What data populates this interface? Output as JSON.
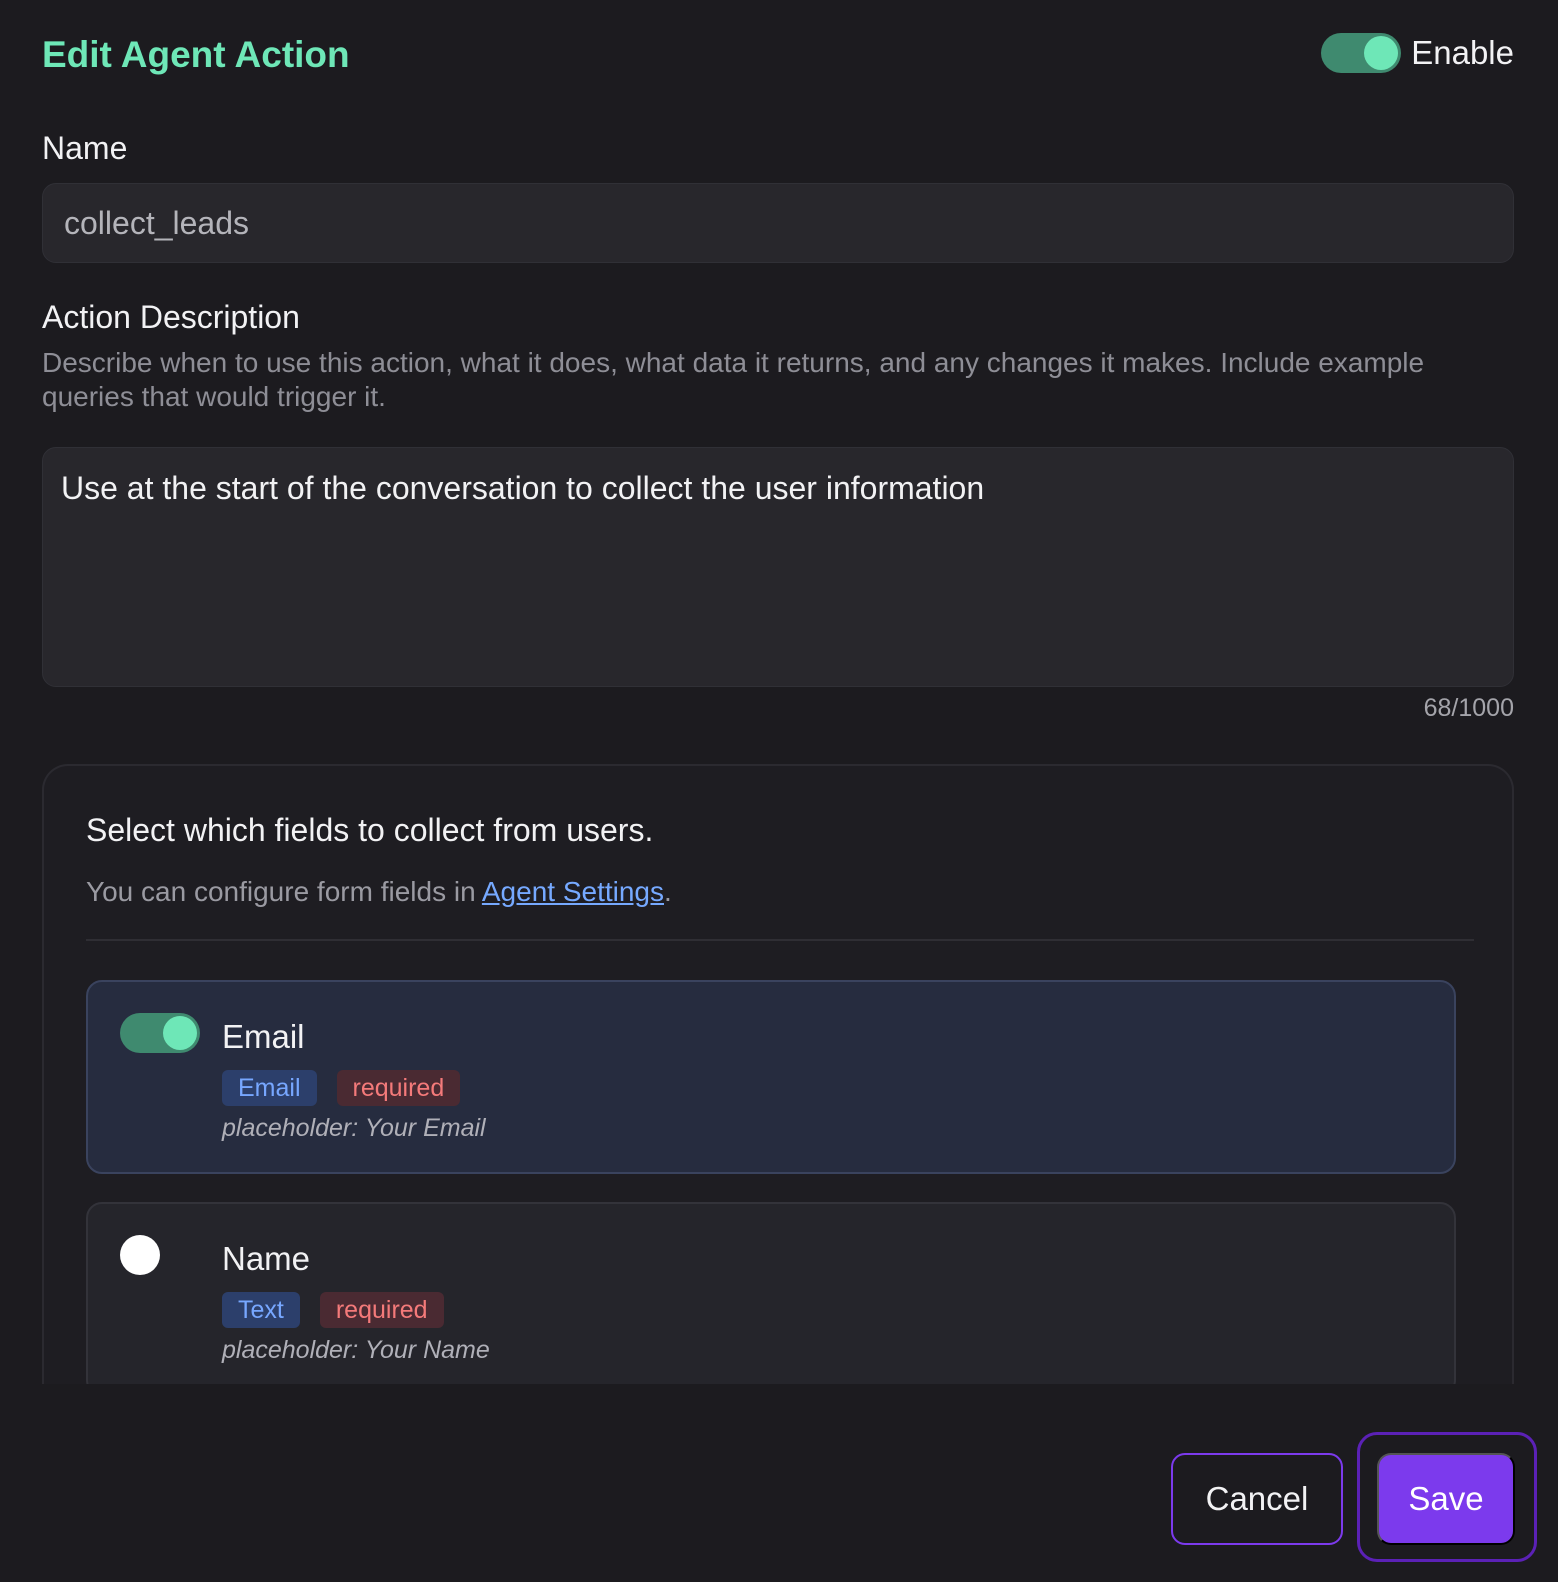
{
  "header": {
    "title": "Edit Agent Action",
    "enable_label": "Enable",
    "enabled": true
  },
  "name_field": {
    "label": "Name",
    "value": "collect_leads"
  },
  "description": {
    "label": "Action Description",
    "help_text": "Describe when to use this action, what it does, what data it returns, and any changes it makes. Include example queries that would trigger it.",
    "value": "Use at the start of the conversation to collect the user information",
    "counter": "68/1000"
  },
  "fields_panel": {
    "heading": "Select which fields to collect from users.",
    "sub_prefix": "You can configure form fields in ",
    "sub_link": "Agent Settings",
    "sub_suffix": ".",
    "fields": [
      {
        "title": "Email",
        "type_badge": "Email",
        "required_badge": "required",
        "placeholder": "placeholder: Your Email",
        "selected": true
      },
      {
        "title": "Name",
        "type_badge": "Text",
        "required_badge": "required",
        "placeholder": "placeholder: Your Name",
        "selected": false
      }
    ]
  },
  "footer": {
    "cancel_label": "Cancel",
    "save_label": "Save"
  },
  "colors": {
    "accent_green": "#6ee7b7",
    "primary_purple": "#7c3aed",
    "link_blue": "#76a9ff",
    "required_red": "#f47a7a"
  }
}
